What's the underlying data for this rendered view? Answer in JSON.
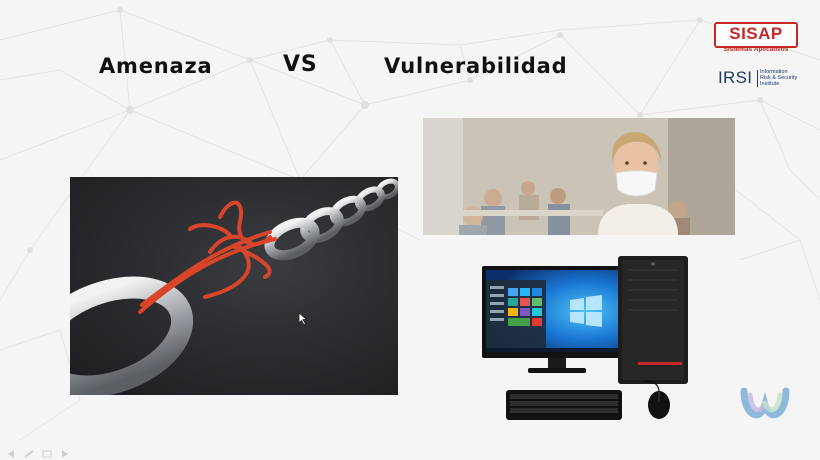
{
  "slide": {
    "title_left": "Amenaza",
    "title_vs": "VS",
    "title_right": "Vulnerabilidad"
  },
  "logos": {
    "sisap_name": "SISAP",
    "sisap_subtitle": "Sistemas Aplicativos",
    "irsi_name": "IRSI",
    "irsi_line1": "Information",
    "irsi_line2": "Risk & Security",
    "irsi_line3": "Institute"
  },
  "images": {
    "left": "chain-held-by-rope-icon",
    "top_right": "masked-teacher-classroom-icon",
    "bottom_right": "desktop-computer-icon"
  },
  "colors": {
    "background": "#f5f5f5",
    "title": "#111111",
    "sisap_red": "#c62828",
    "irsi_blue": "#1f3a6b",
    "rope": "#d9452a",
    "win_blue": "#1565c0"
  }
}
